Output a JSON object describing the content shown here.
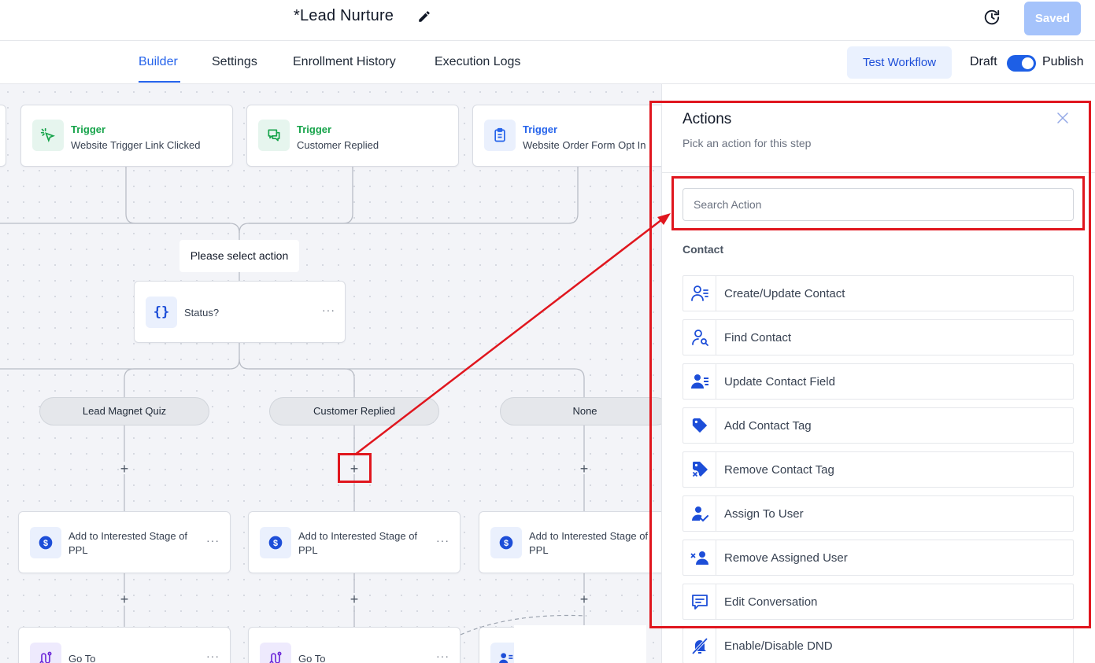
{
  "header": {
    "workflow_title": "*Lead Nurture",
    "saved_label": "Saved"
  },
  "tabs": [
    {
      "label": "Builder",
      "active": true
    },
    {
      "label": "Settings",
      "active": false
    },
    {
      "label": "Enrollment History",
      "active": false
    },
    {
      "label": "Execution Logs",
      "active": false
    }
  ],
  "toolbar": {
    "test_workflow_label": "Test Workflow",
    "draft_label": "Draft",
    "publish_label": "Publish",
    "publish_toggle_on": true
  },
  "canvas": {
    "triggers": [
      {
        "title": "Trigger",
        "subtitle": "Website Trigger Link Clicked",
        "icon": "cursor-click-icon",
        "color": "#16a34a"
      },
      {
        "title": "Trigger",
        "subtitle": "Customer Replied",
        "icon": "chat-icon",
        "color": "#16a34a"
      },
      {
        "title": "Trigger",
        "subtitle": "Website Order Form Opt In",
        "icon": "clipboard-icon",
        "color": "#2563eb"
      }
    ],
    "select_action_label": "Please select action",
    "condition": {
      "label": "Status?",
      "icon": "braces-icon"
    },
    "branches": [
      "Lead Magnet Quiz",
      "Customer Replied",
      "None"
    ],
    "actions": [
      {
        "label": "Add to Interested Stage of PPL",
        "icon": "dollar-icon"
      },
      {
        "label": "Add to Interested Stage of PPL",
        "icon": "dollar-icon"
      },
      {
        "label": "Add to Interested Stage of PPL",
        "icon": "dollar-icon"
      }
    ],
    "goto_label": "Go To"
  },
  "panel": {
    "title": "Actions",
    "subtitle": "Pick an action for this step",
    "search_placeholder": "Search Action",
    "group_label": "Contact",
    "items": [
      {
        "label": "Create/Update Contact",
        "icon": "user-list-icon"
      },
      {
        "label": "Find Contact",
        "icon": "user-search-icon"
      },
      {
        "label": "Update Contact Field",
        "icon": "user-edit-icon"
      },
      {
        "label": "Add Contact Tag",
        "icon": "tag-icon"
      },
      {
        "label": "Remove Contact Tag",
        "icon": "tag-remove-icon"
      },
      {
        "label": "Assign To User",
        "icon": "user-check-icon"
      },
      {
        "label": "Remove Assigned User",
        "icon": "user-remove-icon"
      },
      {
        "label": "Edit Conversation",
        "icon": "message-icon"
      },
      {
        "label": "Enable/Disable DND",
        "icon": "bell-off-icon"
      }
    ]
  },
  "colors": {
    "accent": "#2563eb",
    "annotation": "#e0161e",
    "trigger_green": "#16a34a"
  }
}
